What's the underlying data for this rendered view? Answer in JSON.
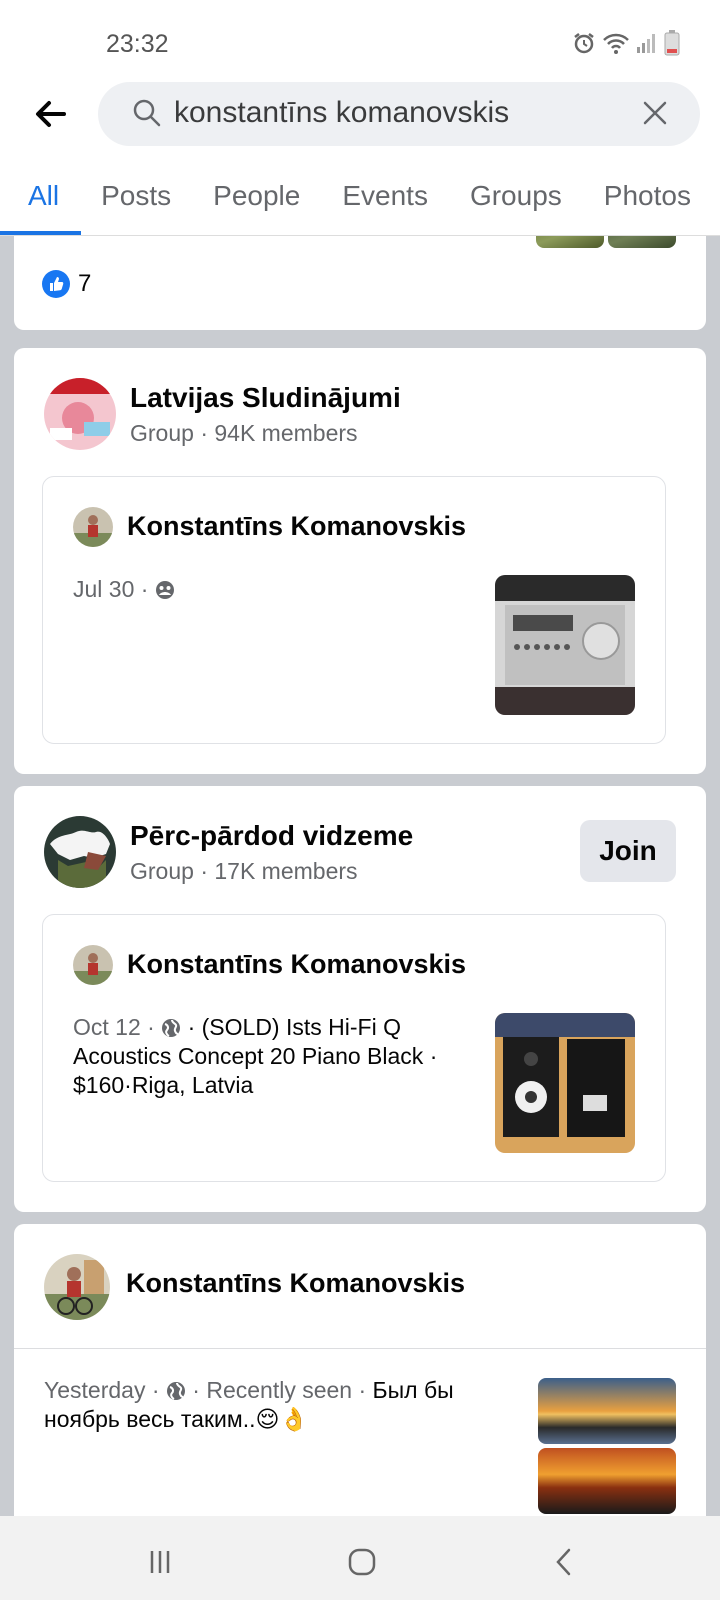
{
  "status_bar": {
    "time": "23:32"
  },
  "search": {
    "query": "konstantīns komanovskis"
  },
  "tabs": [
    "All",
    "Posts",
    "People",
    "Events",
    "Groups",
    "Photos"
  ],
  "results": {
    "first_card": {
      "like_count": "7"
    },
    "group1": {
      "name": "Latvijas Sludinājumi",
      "subtitle": "Group · 94K members",
      "post": {
        "author": "Konstantīns Komanovskis",
        "date": "Jul 30 ·"
      }
    },
    "group2": {
      "name": "Pērc-pārdod vidzeme",
      "subtitle": "Group · 17K members",
      "join_label": "Join",
      "post": {
        "author": "Konstantīns Komanovskis",
        "date": "Oct 12 ·",
        "text": "· (SOLD) Ists Hi-Fi Q Acoustics Concept 20 Piano Black · $160·Riga, Latvia"
      }
    },
    "person_post": {
      "author": "Konstantīns Komanovskis",
      "meta": "Yesterday ·",
      "meta2": "· Recently seen ·",
      "text": "Был бы ноябрь весь таким..😌👌"
    }
  },
  "colors": {
    "accent": "#1b74e4",
    "like_blue": "#1877f2",
    "bg": "#c9ccd1"
  }
}
